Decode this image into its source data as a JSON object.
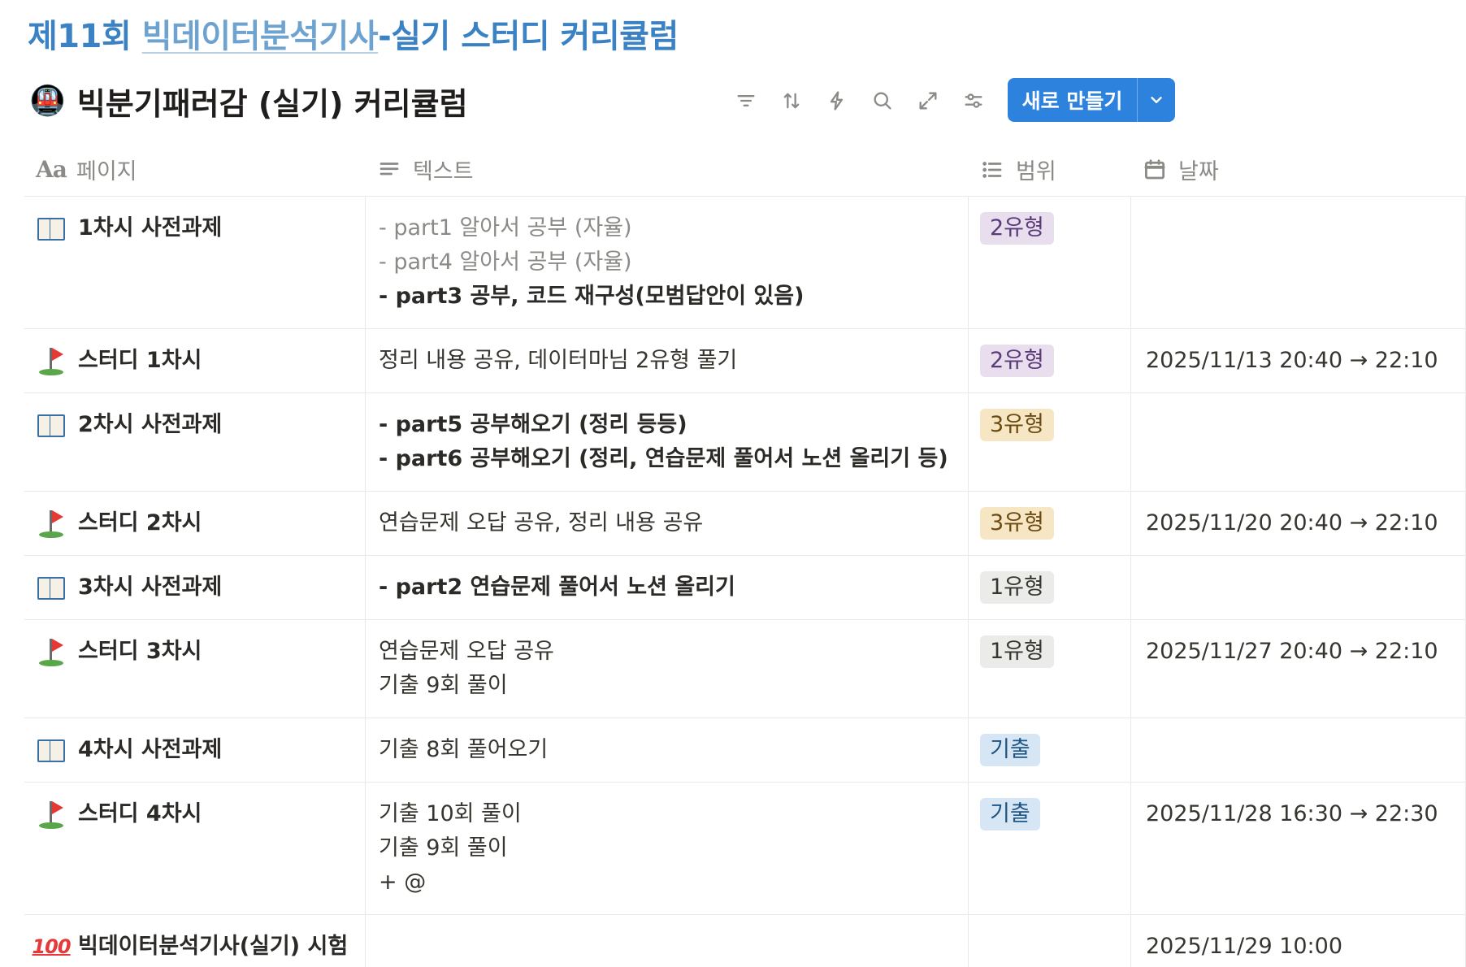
{
  "page": {
    "heading_prefix": "제11회 ",
    "heading_link": "빅데이터분석기사",
    "heading_suffix": "-실기 스터디 커리큘럼"
  },
  "database": {
    "icon": "train-emoji",
    "icon_glyph": "🚇",
    "title": "빅분기패러감 (실기) 커리큘럼"
  },
  "toolbar": {
    "icons": [
      "filter-icon",
      "sort-icon",
      "automation-icon",
      "search-icon",
      "expand-icon",
      "settings-icon"
    ],
    "new_button_label": "새로 만들기",
    "new_button_color": "#2d82dd"
  },
  "columns": {
    "page": "페이지",
    "page_icon_glyph": "Aa",
    "text": "텍스트",
    "range": "범위",
    "date": "날짜"
  },
  "tag_colors": {
    "2유형": {
      "bg": "#e8deee",
      "fg": "#5a3a78"
    },
    "3유형": {
      "bg": "#f6e6c4",
      "fg": "#6b4a12"
    },
    "1유형": {
      "bg": "#ebebea",
      "fg": "#37352f"
    },
    "기출": {
      "bg": "#d6e6f5",
      "fg": "#1f5582"
    }
  },
  "rows": [
    {
      "icon": "book-icon",
      "name": "1차시 사전과제",
      "text": [
        {
          "t": "- part1 알아서 공부 (자율)",
          "style": "muted"
        },
        {
          "t": "- part4 알아서 공부 (자율)",
          "style": "muted"
        },
        {
          "t": "- part3 공부, 코드 재구성(모범답안이 있음)",
          "style": "bold"
        }
      ],
      "range": "2유형",
      "date": ""
    },
    {
      "icon": "flag-icon",
      "name": "스터디 1차시",
      "text": [
        {
          "t": "정리 내용 공유, 데이터마님 2유형 풀기",
          "style": "normal"
        }
      ],
      "range": "2유형",
      "date": "2025/11/13 20:40 → 22:10"
    },
    {
      "icon": "book-icon",
      "name": "2차시 사전과제",
      "text": [
        {
          "t": "- part5 공부해오기 (정리 등등)",
          "style": "bold"
        },
        {
          "t": "- part6 공부해오기 (정리, 연습문제 풀어서 노션 올리기 등)",
          "style": "bold"
        }
      ],
      "range": "3유형",
      "date": ""
    },
    {
      "icon": "flag-icon",
      "name": "스터디 2차시",
      "text": [
        {
          "t": "연습문제 오답 공유, 정리 내용 공유",
          "style": "normal"
        }
      ],
      "range": "3유형",
      "date": "2025/11/20 20:40 → 22:10"
    },
    {
      "icon": "book-icon",
      "name": "3차시 사전과제",
      "text": [
        {
          "t": "- part2 연습문제 풀어서 노션 올리기",
          "style": "bold"
        }
      ],
      "range": "1유형",
      "date": ""
    },
    {
      "icon": "flag-icon",
      "name": "스터디 3차시",
      "text": [
        {
          "t": "연습문제 오답 공유",
          "style": "normal"
        },
        {
          "t": "기출 9회 풀이",
          "style": "normal"
        }
      ],
      "range": "1유형",
      "date": "2025/11/27 20:40 → 22:10"
    },
    {
      "icon": "book-icon",
      "name": "4차시 사전과제",
      "text": [
        {
          "t": "기출 8회 풀어오기",
          "style": "normal"
        }
      ],
      "range": "기출",
      "date": ""
    },
    {
      "icon": "flag-icon",
      "name": "스터디 4차시",
      "text": [
        {
          "t": "기출 10회 풀이",
          "style": "normal"
        },
        {
          "t": "기출 9회 풀이",
          "style": "normal"
        },
        {
          "t": "+ @",
          "style": "normal"
        }
      ],
      "range": "기출",
      "date": "2025/11/28 16:30 → 22:30"
    },
    {
      "icon": "hundred-icon",
      "name": "빅데이터분석기사(실기) 시험",
      "text": [],
      "range": "",
      "date": "2025/11/29 10:00"
    }
  ]
}
